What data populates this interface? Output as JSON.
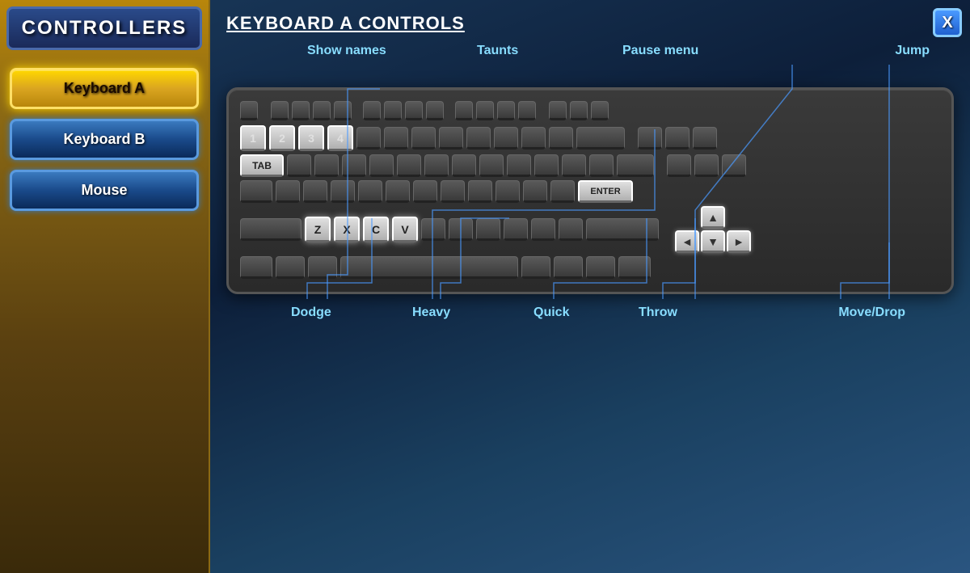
{
  "sidebar": {
    "title": "CONTROLLERS",
    "buttons": [
      {
        "label": "Keyboard A",
        "id": "keyboard-a",
        "active": true
      },
      {
        "label": "Keyboard B",
        "id": "keyboard-b",
        "active": false
      },
      {
        "label": "Mouse",
        "id": "mouse",
        "active": false
      }
    ]
  },
  "main": {
    "title": "KEYBOARD A CONTROLS",
    "close_label": "X",
    "labels_top": {
      "show_names": "Show names",
      "taunts": "Taunts",
      "pause_menu": "Pause menu",
      "jump": "Jump"
    },
    "labels_bottom": {
      "dodge": "Dodge",
      "heavy": "Heavy",
      "quick": "Quick",
      "throw": "Throw",
      "move_drop": "Move/Drop"
    }
  },
  "keys": {
    "highlighted_row1": [
      "1",
      "2",
      "3",
      "4"
    ],
    "tab": "TAB",
    "enter": "ENTER",
    "highlighted_zxcv": [
      "Z",
      "X",
      "C",
      "V"
    ],
    "arrows": {
      "up": "▲",
      "left": "◄",
      "down": "▼",
      "right": "►"
    }
  }
}
